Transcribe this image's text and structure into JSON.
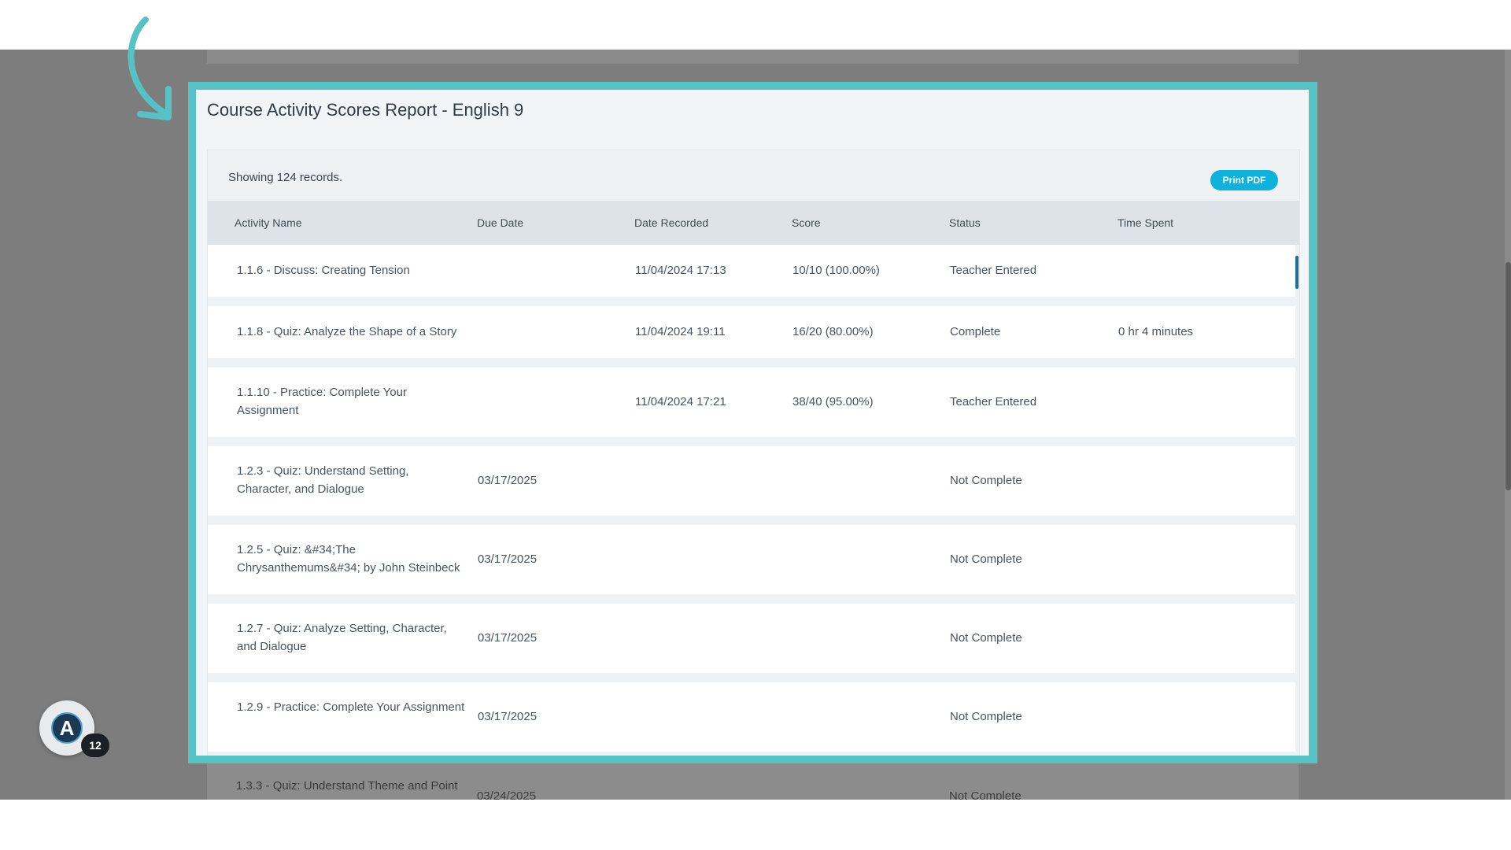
{
  "dialog": {
    "title": "Course Activity Scores Report - English 9",
    "records_text": "Showing 124 records.",
    "print_label": "Print PDF"
  },
  "columns": [
    "Activity Name",
    "Due Date",
    "Date Recorded",
    "Score",
    "Status",
    "Time Spent"
  ],
  "rows": [
    {
      "name": "1.1.6 - Discuss: Creating Tension",
      "due": "",
      "recorded": "11/04/2024 17:13",
      "score": "10/10 (100.00%)",
      "status": "Teacher Entered",
      "time": ""
    },
    {
      "name": "1.1.8 - Quiz: Analyze the Shape of a Story",
      "due": "",
      "recorded": "11/04/2024 19:11",
      "score": "16/20 (80.00%)",
      "status": "Complete",
      "time": "0 hr 4 minutes"
    },
    {
      "name": "1.1.10 - Practice: Complete Your Assignment",
      "due": "",
      "recorded": "11/04/2024 17:21",
      "score": "38/40 (95.00%)",
      "status": "Teacher Entered",
      "time": ""
    },
    {
      "name": "1.2.3 - Quiz: Understand Setting, Character, and Dialogue",
      "due": "03/17/2025",
      "recorded": "",
      "score": "",
      "status": "Not Complete",
      "time": ""
    },
    {
      "name": "1.2.5 - Quiz: &#34;The Chrysanthemums&#34; by John Steinbeck",
      "due": "03/17/2025",
      "recorded": "",
      "score": "",
      "status": "Not Complete",
      "time": ""
    },
    {
      "name": "1.2.7 - Quiz: Analyze Setting, Character, and Dialogue",
      "due": "03/17/2025",
      "recorded": "",
      "score": "",
      "status": "Not Complete",
      "time": ""
    },
    {
      "name": "1.2.9 - Practice: Complete Your Assignment",
      "due": "03/17/2025",
      "recorded": "",
      "score": "",
      "status": "Not Complete",
      "time": ""
    }
  ],
  "background_row": {
    "name": "1.3.3 - Quiz: Understand Theme and Point",
    "due": "03/24/2025",
    "status": "Not Complete"
  },
  "badge": {
    "logo": "A",
    "count": "12"
  },
  "colors": {
    "highlight": "#57c2c6",
    "print_button": "#0fb1dd",
    "overlay": "#7d7d7d"
  }
}
